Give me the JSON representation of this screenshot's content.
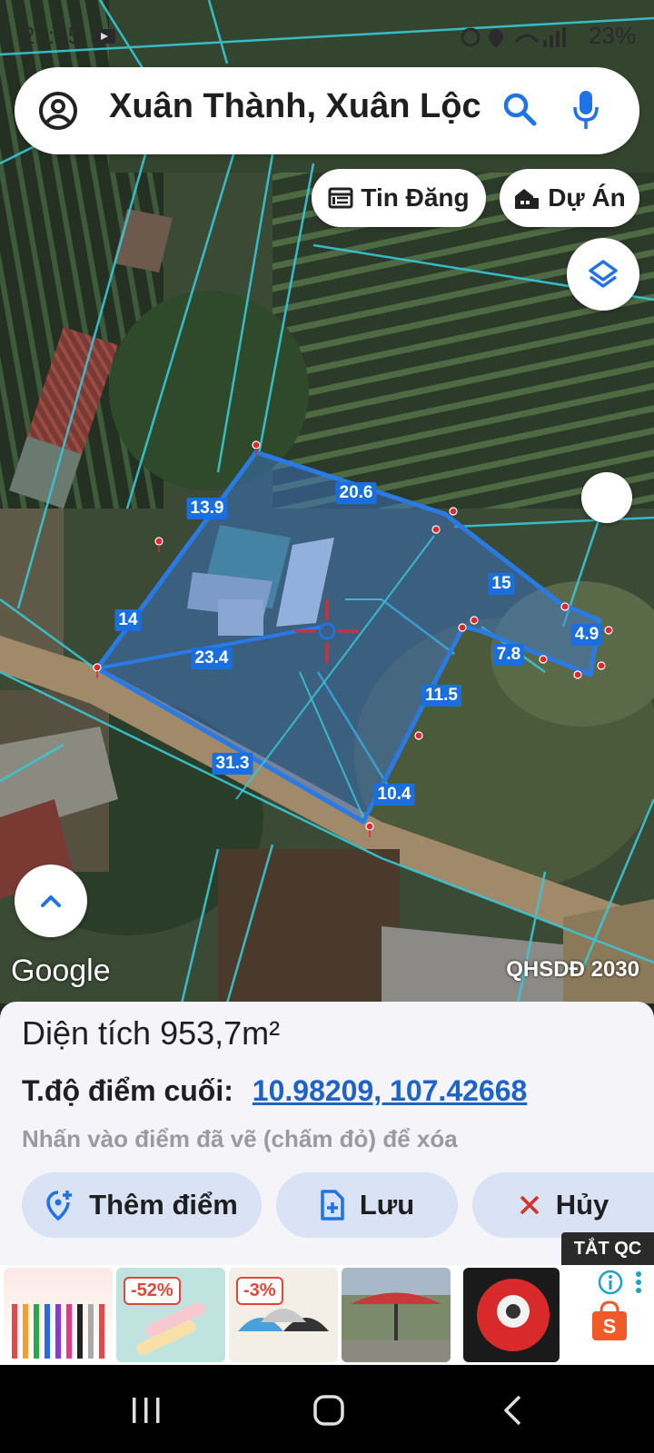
{
  "status_bar": {
    "time": "21:25",
    "battery": "23%"
  },
  "search": {
    "location": "Xuân Thành, Xuân Lộc"
  },
  "chips": {
    "listings": "Tin Đăng",
    "projects": "Dự Án"
  },
  "map": {
    "attribution": "Google",
    "layer_name": "QHSDĐ 2030",
    "segment_labels": [
      "13.9",
      "20.6",
      "15",
      "4.9",
      "7.8",
      "11.5",
      "10.4",
      "31.3",
      "14",
      "23.4"
    ]
  },
  "panel": {
    "area_label": "Diện tích",
    "area_value": "953,7m²",
    "coord_label": "T.độ điểm cuối:",
    "coord_value": "10.98209, 107.42668",
    "hint": "Nhấn vào điểm đã vẽ (chấm đỏ) để xóa",
    "add_point": "Thêm điểm",
    "save": "Lưu",
    "cancel": "Hủy"
  },
  "ads": {
    "close_label": "TẮT QC",
    "badge_1": "-52%",
    "badge_2": "-3%"
  },
  "icons": {
    "search": "search-icon",
    "mic": "mic-icon",
    "account": "account-icon",
    "layers": "layers-icon",
    "expand": "chevron-up-icon"
  },
  "colors": {
    "parcel_outline": "#2a7ae4",
    "parcel_fill": "#3d7bd8",
    "boundary": "#38c8d8",
    "link": "#1e63c8",
    "action_bg": "#d9e3f5"
  }
}
